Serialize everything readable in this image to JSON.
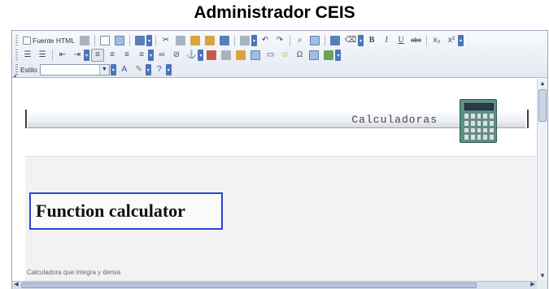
{
  "page": {
    "title": "Administrador CEIS"
  },
  "toolbar": {
    "source_label": "Fuente HTML",
    "style_label": "Estilo",
    "style_value": "",
    "bold": "B",
    "italic": "I",
    "underline": "U",
    "strike": "abc",
    "subscript": "x₂",
    "superscript": "x²"
  },
  "content": {
    "banner_title": "Calculadoras",
    "heading": "Function calculator",
    "subtext": "Calculadora que integra y deriva"
  },
  "scroll": {
    "up": "▲",
    "down": "▼",
    "left": "◀",
    "right": "▶"
  }
}
